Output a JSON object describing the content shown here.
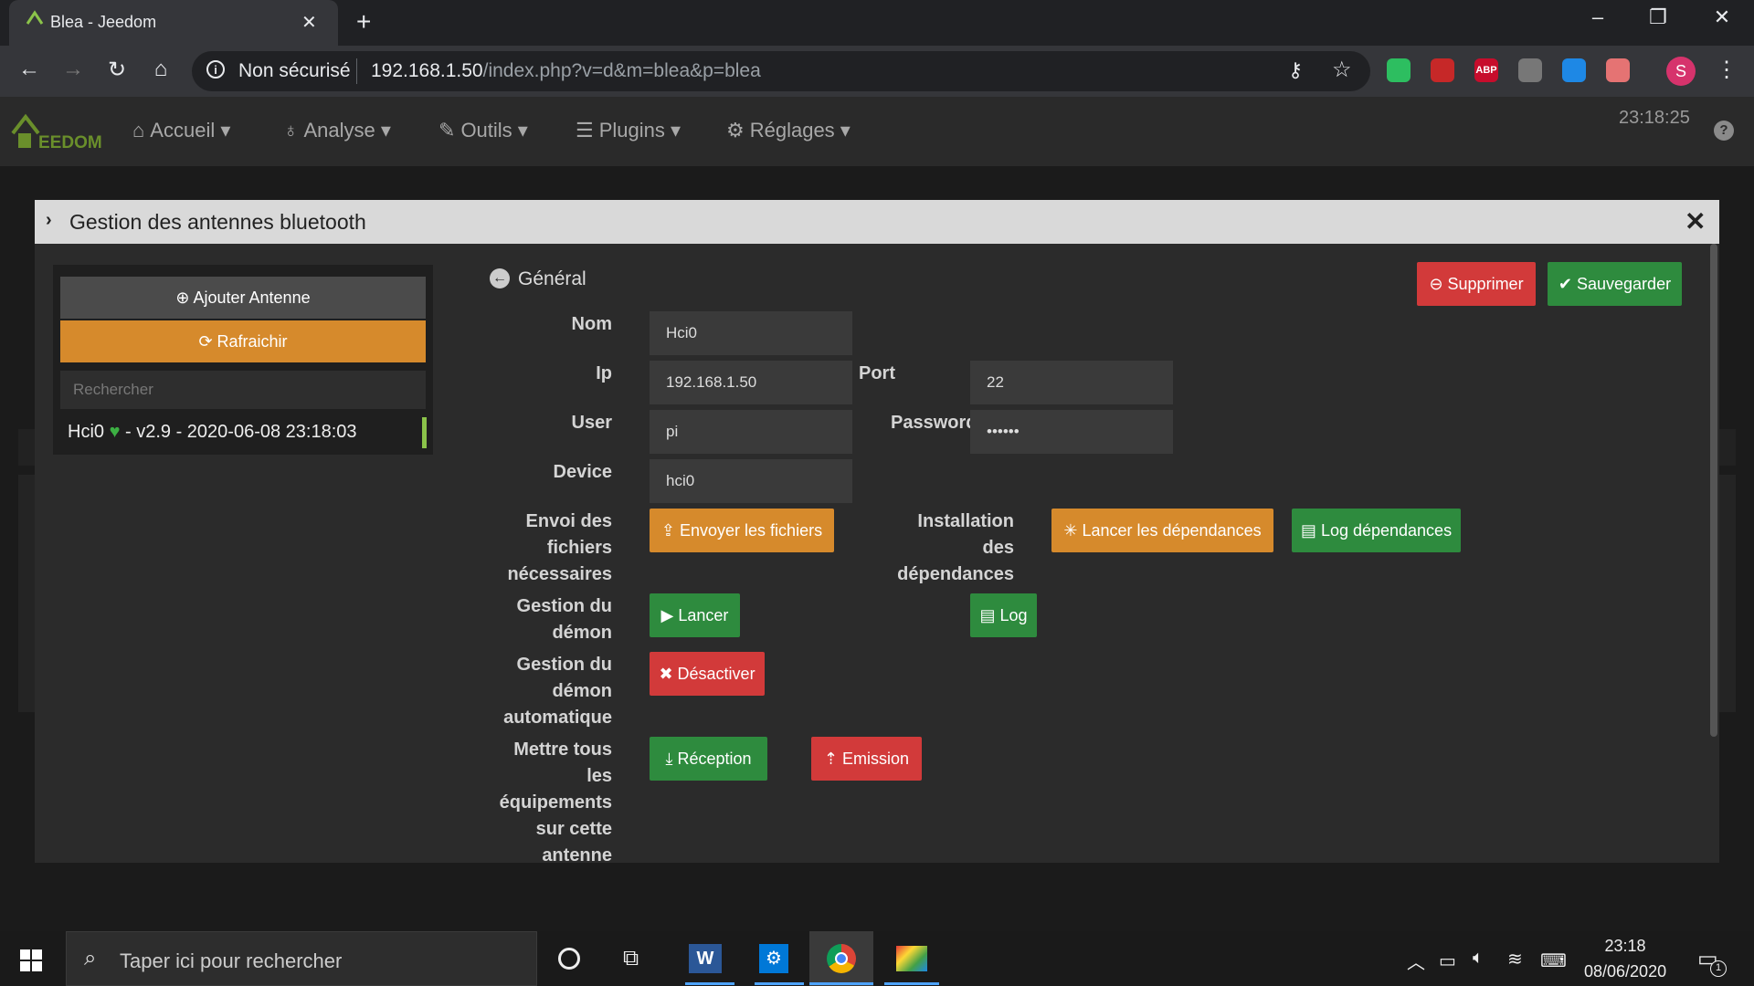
{
  "browser": {
    "tab_title": "Blea - Jeedom",
    "tab_close": "✕",
    "new_tab": "+",
    "security_label": "Non sécurisé",
    "url_host": "192.168.1.50",
    "url_path": "/index.php?v=d&m=blea&p=blea",
    "profile_initial": "S",
    "extensions": [
      {
        "name": "evernote-icon",
        "label": "",
        "color": "#2dbe60"
      },
      {
        "name": "acrobat-icon",
        "label": "",
        "color": "#c62828"
      },
      {
        "name": "adblock-plus-icon",
        "label": "ABP",
        "color": "#c70d2c"
      },
      {
        "name": "extension-dots-icon",
        "label": "",
        "color": "#777777"
      },
      {
        "name": "screen-capture-icon",
        "label": "",
        "color": "#1e88e5"
      },
      {
        "name": "glasses-icon",
        "label": "",
        "color": "#e57373"
      }
    ]
  },
  "jeedom": {
    "logo_text": "EEDOM",
    "menu": [
      {
        "label": "Accueil",
        "icon": "home-icon"
      },
      {
        "label": "Analyse",
        "icon": "stethoscope-icon"
      },
      {
        "label": "Outils",
        "icon": "wrench-icon"
      },
      {
        "label": "Plugins",
        "icon": "list-icon"
      },
      {
        "label": "Réglages",
        "icon": "cog-icon"
      }
    ],
    "time": "23:18:25",
    "help": "?"
  },
  "modal": {
    "title": "Gestion des antennes bluetooth",
    "close": "✕",
    "left": {
      "add_label": "Ajouter Antenne",
      "refresh_label": "Rafraichir",
      "search_placeholder": "Rechercher",
      "antenna_name": "Hci0",
      "antenna_info": " - v2.9 - 2020-06-08 23:18:03"
    },
    "section_title": "Général",
    "delete_label": "Supprimer",
    "save_label": "Sauvegarder",
    "fields": {
      "nom_label": "Nom",
      "nom_value": "Hci0",
      "ip_label": "Ip",
      "ip_value": "192.168.1.50",
      "port_label": "Port",
      "port_value": "22",
      "user_label": "User",
      "user_value": "pi",
      "password_label": "Password",
      "password_value": "••••••",
      "device_label": "Device",
      "device_value": "hci0"
    },
    "envoi_label": [
      "Envoi des",
      "fichiers",
      "nécessaires"
    ],
    "envoi_button": "Envoyer les fichiers",
    "install_label": [
      "Installation",
      "des",
      "dépendances"
    ],
    "lancer_dep_button": "Lancer les dépendances",
    "log_dep_button": "Log dépendances",
    "demon_label": [
      "Gestion du",
      "démon"
    ],
    "lancer_button": "Lancer",
    "log_button": "Log",
    "demon_auto_label": [
      "Gestion du",
      "démon",
      "automatique"
    ],
    "desactiver_button": "Désactiver",
    "mettre_label": [
      "Mettre tous",
      "les",
      "équipements",
      "sur cette",
      "antenne"
    ],
    "reception_button": "Réception",
    "emission_button": "Emission"
  },
  "taskbar": {
    "search_placeholder": "Taper ici pour rechercher",
    "clock_time": "23:18",
    "clock_date": "08/06/2020",
    "notif_count": "1"
  }
}
